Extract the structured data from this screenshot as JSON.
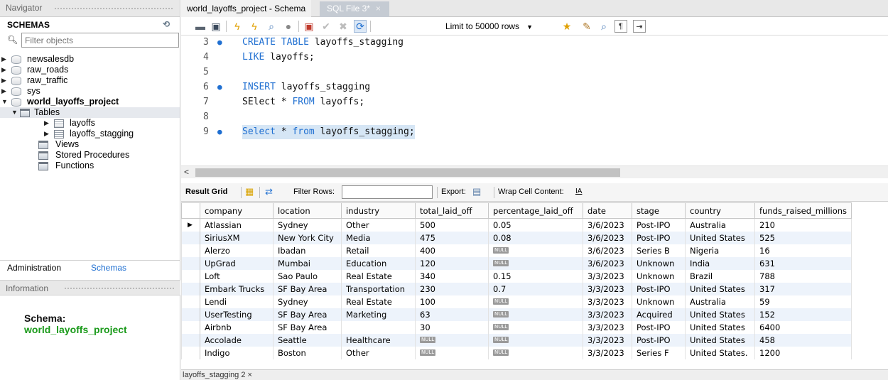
{
  "navigator": {
    "header": "Navigator",
    "schemas_title": "SCHEMAS",
    "filter_placeholder": "Filter objects",
    "databases": [
      "newsalesdb",
      "raw_roads",
      "raw_traffic",
      "sys"
    ],
    "active_db": "world_layoffs_project",
    "tables_label": "Tables",
    "tables": [
      "layoffs",
      "layoffs_stagging"
    ],
    "views_label": "Views",
    "procedures_label": "Stored Procedures",
    "functions_label": "Functions"
  },
  "admin_tabs": {
    "administration": "Administration",
    "schemas": "Schemas"
  },
  "information": {
    "header": "Information",
    "schema_key": "Schema:",
    "schema_value": "world_layoffs_project"
  },
  "editor_tabs": {
    "tab1": "world_layoffs_project - Schema",
    "tab2": "SQL File 3*",
    "close": "×"
  },
  "toolbar": {
    "limit_label": "Limit to 50000 rows"
  },
  "editor": {
    "lines": [
      {
        "num": "3",
        "dot": true
      },
      {
        "num": "4",
        "dot": false
      },
      {
        "num": "5",
        "dot": false
      },
      {
        "num": "6",
        "dot": true
      },
      {
        "num": "7",
        "dot": false
      },
      {
        "num": "8",
        "dot": false
      },
      {
        "num": "9",
        "dot": true
      }
    ],
    "code": {
      "l3_kw": "CREATE TABLE",
      "l3_rest": " layoffs_stagging",
      "l4_kw": "LIKE",
      "l4_rest": " layoffs;",
      "l6_kw": "INSERT",
      "l6_rest": " layoffs_stagging",
      "l7_a": "SElect * ",
      "l7_kw": "FROM",
      "l7_rest": " layoffs;",
      "l9_kw1": "Select",
      "l9_mid": " * ",
      "l9_kw2": "from",
      "l9_rest": " layoffs_stagging;"
    }
  },
  "result_bar": {
    "result_grid": "Result Grid",
    "filter_rows": "Filter Rows:",
    "export": "Export:",
    "wrap": "Wrap Cell Content:"
  },
  "grid": {
    "columns": [
      "company",
      "location",
      "industry",
      "total_laid_off",
      "percentage_laid_off",
      "date",
      "stage",
      "country",
      "funds_raised_millions"
    ],
    "null_label": "NULL",
    "rows": [
      [
        "Atlassian",
        "Sydney",
        "Other",
        "500",
        "0.05",
        "3/6/2023",
        "Post-IPO",
        "Australia",
        "210"
      ],
      [
        "SiriusXM",
        "New York City",
        "Media",
        "475",
        "0.08",
        "3/6/2023",
        "Post-IPO",
        "United States",
        "525"
      ],
      [
        "Alerzo",
        "Ibadan",
        "Retail",
        "400",
        null,
        "3/6/2023",
        "Series B",
        "Nigeria",
        "16"
      ],
      [
        "UpGrad",
        "Mumbai",
        "Education",
        "120",
        null,
        "3/6/2023",
        "Unknown",
        "India",
        "631"
      ],
      [
        "Loft",
        "Sao Paulo",
        "Real Estate",
        "340",
        "0.15",
        "3/3/2023",
        "Unknown",
        "Brazil",
        "788"
      ],
      [
        "Embark Trucks",
        "SF Bay Area",
        "Transportation",
        "230",
        "0.7",
        "3/3/2023",
        "Post-IPO",
        "United States",
        "317"
      ],
      [
        "Lendi",
        "Sydney",
        "Real Estate",
        "100",
        null,
        "3/3/2023",
        "Unknown",
        "Australia",
        "59"
      ],
      [
        "UserTesting",
        "SF Bay Area",
        "Marketing",
        "63",
        null,
        "3/3/2023",
        "Acquired",
        "United States",
        "152"
      ],
      [
        "Airbnb",
        "SF Bay Area",
        "",
        "30",
        null,
        "3/3/2023",
        "Post-IPO",
        "United States",
        "6400"
      ],
      [
        "Accolade",
        "Seattle",
        "Healthcare",
        null,
        null,
        "3/3/2023",
        "Post-IPO",
        "United States",
        "458"
      ],
      [
        "Indigo",
        "Boston",
        "Other",
        null,
        null,
        "3/3/2023",
        "Series F",
        "United States.",
        "1200"
      ]
    ]
  },
  "bottom_tab": {
    "label": "layoffs_stagging 2",
    "close": "×"
  },
  "colors": {
    "keyword": "#1f6fd1",
    "schema_value": "#1a9a1a",
    "highlight": "#d6e6f5",
    "alt_row": "#edf3fb"
  }
}
